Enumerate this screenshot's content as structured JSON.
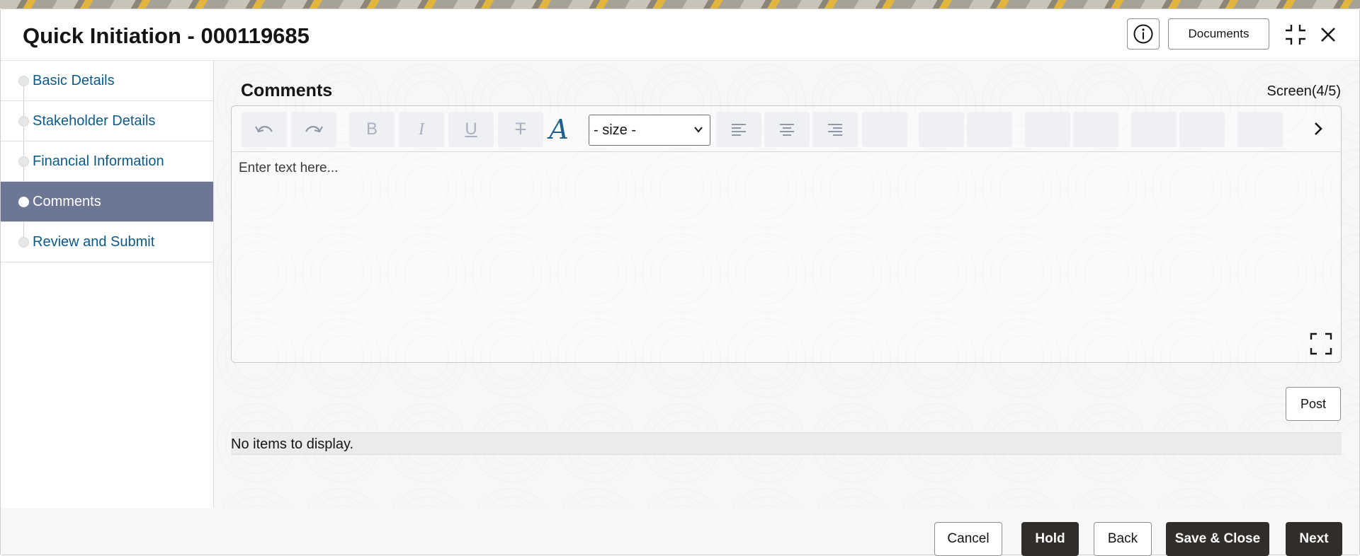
{
  "header": {
    "title": "Quick Initiation - 000119685",
    "documents_label": "Documents"
  },
  "sidebar": {
    "items": [
      {
        "label": "Basic Details",
        "active": false
      },
      {
        "label": "Stakeholder Details",
        "active": false
      },
      {
        "label": "Financial Information",
        "active": false
      },
      {
        "label": "Comments",
        "active": true
      },
      {
        "label": "Review and Submit",
        "active": false
      }
    ]
  },
  "main": {
    "section_title": "Comments",
    "screen_indicator": "Screen(4/5)",
    "editor": {
      "size_select_value": "- size -",
      "placeholder": "Enter text here..."
    },
    "post_label": "Post",
    "empty_message": "No items to display."
  },
  "footer": {
    "cancel_label": "Cancel",
    "hold_label": "Hold",
    "back_label": "Back",
    "save_close_label": "Save & Close",
    "next_label": "Next"
  },
  "colors": {
    "active_nav_bg": "#6b7794",
    "nav_link": "#0a5a8a",
    "primary_button": "#312d2a",
    "toolbar_icon": "#aab1bd",
    "font_icon_accent": "#1f5f8b"
  },
  "icons": [
    "info-icon",
    "compress-icon",
    "close-icon",
    "undo-icon",
    "redo-icon",
    "bold-icon",
    "italic-icon",
    "underline-icon",
    "strikethrough-icon",
    "font-icon",
    "align-left-icon",
    "align-center-icon",
    "align-right-icon",
    "chevron-right-icon",
    "expand-icon"
  ]
}
